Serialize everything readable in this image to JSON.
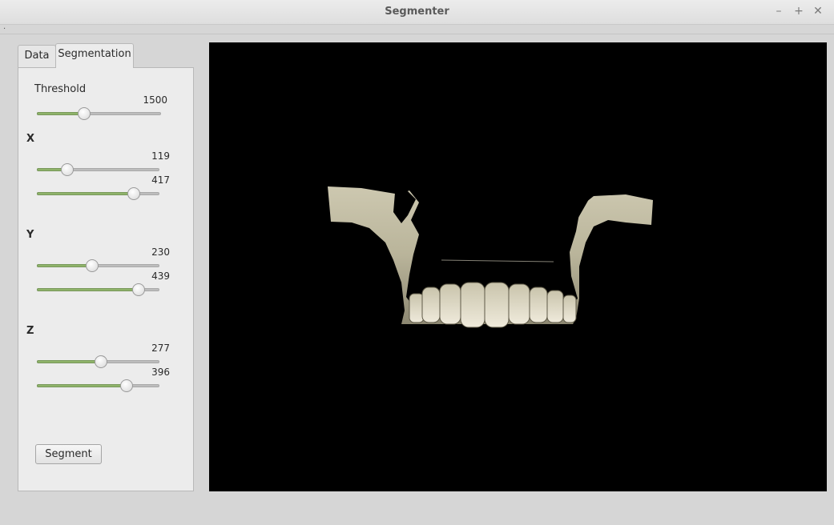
{
  "window": {
    "title": "Segmenter",
    "menu_hint": "."
  },
  "tabs": [
    {
      "label": "Data",
      "active": false
    },
    {
      "label": "Segmentation",
      "active": true
    }
  ],
  "segmentation": {
    "threshold": {
      "label": "Threshold",
      "value": "1500",
      "fraction": 0.38
    },
    "x": {
      "label": "X",
      "min": {
        "value": "119",
        "fraction": 0.25
      },
      "max": {
        "value": "417",
        "fraction": 0.79
      }
    },
    "y": {
      "label": "Y",
      "min": {
        "value": "230",
        "fraction": 0.45
      },
      "max": {
        "value": "439",
        "fraction": 0.83
      }
    },
    "z": {
      "label": "Z",
      "min": {
        "value": "277",
        "fraction": 0.52
      },
      "max": {
        "value": "396",
        "fraction": 0.73
      }
    },
    "segment_button": "Segment"
  },
  "colors": {
    "slider_fill": "#8fb36a",
    "viewport_bg": "#000000",
    "bone": "#d8d3bd"
  }
}
